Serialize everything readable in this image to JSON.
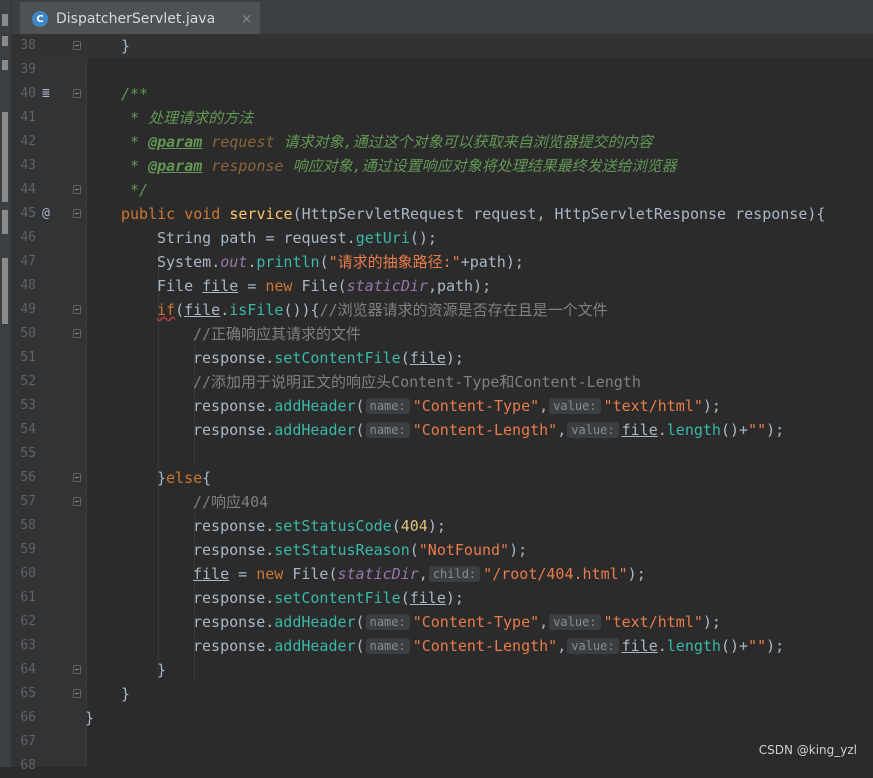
{
  "tab": {
    "title": "DispatcherServlet.java",
    "icon": "java-class-icon",
    "icon_letter": "C",
    "close": "×"
  },
  "lines": [
    {
      "n": "38",
      "fold": true
    },
    {
      "n": "39"
    },
    {
      "n": "40",
      "fold": true,
      "gutter": "≣"
    },
    {
      "n": "41"
    },
    {
      "n": "42"
    },
    {
      "n": "43"
    },
    {
      "n": "44",
      "fold": true
    },
    {
      "n": "45",
      "fold": true,
      "gutter": "@"
    },
    {
      "n": "46"
    },
    {
      "n": "47"
    },
    {
      "n": "48"
    },
    {
      "n": "49",
      "fold": true
    },
    {
      "n": "50",
      "fold": true
    },
    {
      "n": "51"
    },
    {
      "n": "52"
    },
    {
      "n": "53"
    },
    {
      "n": "54"
    },
    {
      "n": "55"
    },
    {
      "n": "56",
      "fold": true
    },
    {
      "n": "57",
      "fold": true
    },
    {
      "n": "58"
    },
    {
      "n": "59"
    },
    {
      "n": "60"
    },
    {
      "n": "61"
    },
    {
      "n": "62"
    },
    {
      "n": "63"
    },
    {
      "n": "64",
      "fold": true
    },
    {
      "n": "65",
      "fold": true
    },
    {
      "n": "66"
    },
    {
      "n": "67"
    },
    {
      "n": "68"
    }
  ],
  "code": {
    "l38": "}",
    "l40": "/**",
    "l41_star": " * ",
    "l41_text": "处理请求的方法",
    "l42_star": " * ",
    "l42_tag": "@param",
    "l42_name": "request",
    "l42_desc": "请求对象,通过这个对象可以获取来自浏览器提交的内容",
    "l43_star": " * ",
    "l43_tag": "@param",
    "l43_name": "response",
    "l43_desc": "响应对象,通过设置响应对象将处理结果最终发送给浏览器",
    "l44": " */",
    "l45": {
      "public": "public",
      "void": "void",
      "name": "service",
      "p1_type": "HttpServletRequest",
      "p1": "request",
      "p2_type": "HttpServletResponse",
      "p2": "response"
    },
    "l46": {
      "type": "String",
      "var": "path",
      "obj": "request",
      "call": "getUri"
    },
    "l47": {
      "cls": "System",
      "field": "out",
      "call": "println",
      "str": "\"请求的抽象路径:\"",
      "arg": "path"
    },
    "l48": {
      "type": "File",
      "var": "file",
      "new": "new",
      "ctor": "File",
      "static": "staticDir",
      "arg": "path"
    },
    "l49": {
      "if": "if",
      "var": "file",
      "call": "isFile",
      "comment": "//浏览器请求的资源是否存在且是一个文件"
    },
    "l50": "//正确响应其请求的文件",
    "l51": {
      "obj": "response",
      "call": "setContentFile",
      "arg": "file"
    },
    "l52": "//添加用于说明正文的响应头Content-Type和Content-Length",
    "l53": {
      "obj": "response",
      "call": "addHeader",
      "h1": "name:",
      "s1": "\"Content-Type\"",
      "h2": "value:",
      "s2": "\"text/html\""
    },
    "l54": {
      "obj": "response",
      "call": "addHeader",
      "h1": "name:",
      "s1": "\"Content-Length\"",
      "h2": "value:",
      "var": "file",
      "call2": "length",
      "s2": "\"\""
    },
    "l56": {
      "brace": "}",
      "else": "else"
    },
    "l57": "//响应404",
    "l58": {
      "obj": "response",
      "call": "setStatusCode",
      "num": "404"
    },
    "l59": {
      "obj": "response",
      "call": "setStatusReason",
      "str": "\"NotFound\""
    },
    "l60": {
      "var": "file",
      "new": "new",
      "ctor": "File",
      "static": "staticDir",
      "hint": "child:",
      "str": "\"/root/404.html\""
    },
    "l61": {
      "obj": "response",
      "call": "setContentFile",
      "arg": "file"
    },
    "l62": {
      "obj": "response",
      "call": "addHeader",
      "h1": "name:",
      "s1": "\"Content-Type\"",
      "h2": "value:",
      "s2": "\"text/html\""
    },
    "l63": {
      "obj": "response",
      "call": "addHeader",
      "h1": "name:",
      "s1": "\"Content-Length\"",
      "h2": "value:",
      "var": "file",
      "call2": "length",
      "s2": "\"\""
    },
    "l64": "}",
    "l65": "}",
    "l66": "}"
  },
  "watermark": "CSDN @king_yzl",
  "colors": {
    "background": "#2b2b2b",
    "keyword": "#cc7832",
    "method": "#ffc66d",
    "string": "#6a8759",
    "comment": "#808080",
    "doc": "#629755"
  }
}
